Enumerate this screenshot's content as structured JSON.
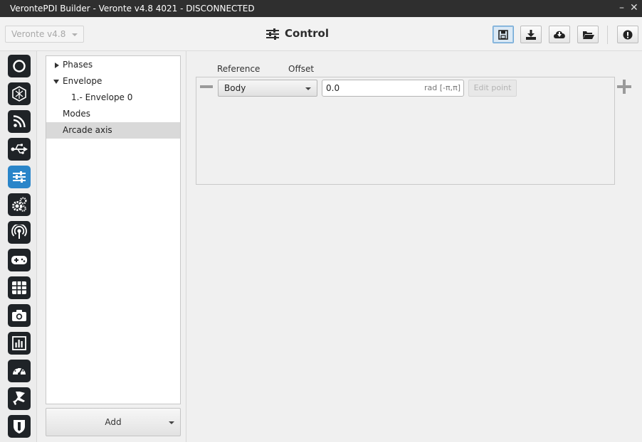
{
  "window": {
    "title": "VerontePDI Builder - Veronte v4.8 4021 - DISCONNECTED",
    "minimize_glyph": "–",
    "close_glyph": "✕"
  },
  "toolbar": {
    "version_select": "Veronte v4.8",
    "page_title": "Control",
    "page_icon": "sliders-icon",
    "buttons": [
      "save-icon",
      "download-icon",
      "cloud-download-icon",
      "folder-open-icon",
      "info-icon"
    ]
  },
  "sidebar": {
    "items": [
      "circle-icon",
      "hexagon-icon",
      "rss-icon",
      "usb-icon",
      "sliders-icon",
      "gears-icon",
      "broadcast-icon",
      "gamepad-icon",
      "grid-icon",
      "camera-icon",
      "chart-icon",
      "gauge-icon",
      "plane-icon",
      "shield-icon"
    ],
    "active_index": 4,
    "active_color": "#2a85c9"
  },
  "tree": {
    "items": [
      {
        "label": "Phases"
      },
      {
        "label": "Envelope"
      },
      {
        "label": "1.- Envelope 0"
      },
      {
        "label": "Modes"
      },
      {
        "label": "Arcade axis"
      }
    ],
    "selected": "Arcade axis",
    "add_label": "Add"
  },
  "main": {
    "headers": {
      "reference": "Reference",
      "offset": "Offset"
    },
    "row": {
      "reference_value": "Body",
      "offset_value": "0.0",
      "offset_unit": "rad [-π,π]",
      "edit_point_label": "Edit point"
    }
  }
}
